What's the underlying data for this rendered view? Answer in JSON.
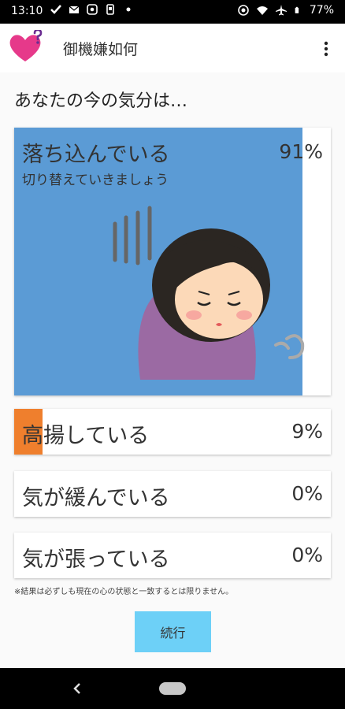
{
  "status_bar": {
    "time": "13:10",
    "battery": "77%",
    "icons": [
      "check-icon",
      "mail-icon",
      "at-icon",
      "phone-icon",
      "dot-icon",
      "vibrate-icon",
      "wifi-icon",
      "airplane-icon",
      "battery-icon"
    ]
  },
  "app_bar": {
    "title": "御機嫌如何",
    "logo_icon": "heart-question-logo",
    "menu_icon": "more-vert-icon"
  },
  "question": "あなたの今の気分は…",
  "moods": [
    {
      "label": "落ち込んでいる",
      "subtitle": "切り替えていきましょう",
      "percent_text": "91%",
      "percent": 91,
      "color": "#5b9bd5"
    },
    {
      "label": "高揚している",
      "percent_text": "9%",
      "percent": 9,
      "color": "#ef7f2d"
    },
    {
      "label": "気が緩んでいる",
      "percent_text": "0%",
      "percent": 0,
      "color": "#5b9bd5"
    },
    {
      "label": "気が張っている",
      "percent_text": "0%",
      "percent": 0,
      "color": "#5b9bd5"
    }
  ],
  "note": "※結果は必ずしも現在の心の状態と一致するとは限りません。",
  "continue_button": "続行",
  "nav": {
    "back_icon": "back-chevron-icon",
    "home_icon": "home-pill-icon"
  }
}
